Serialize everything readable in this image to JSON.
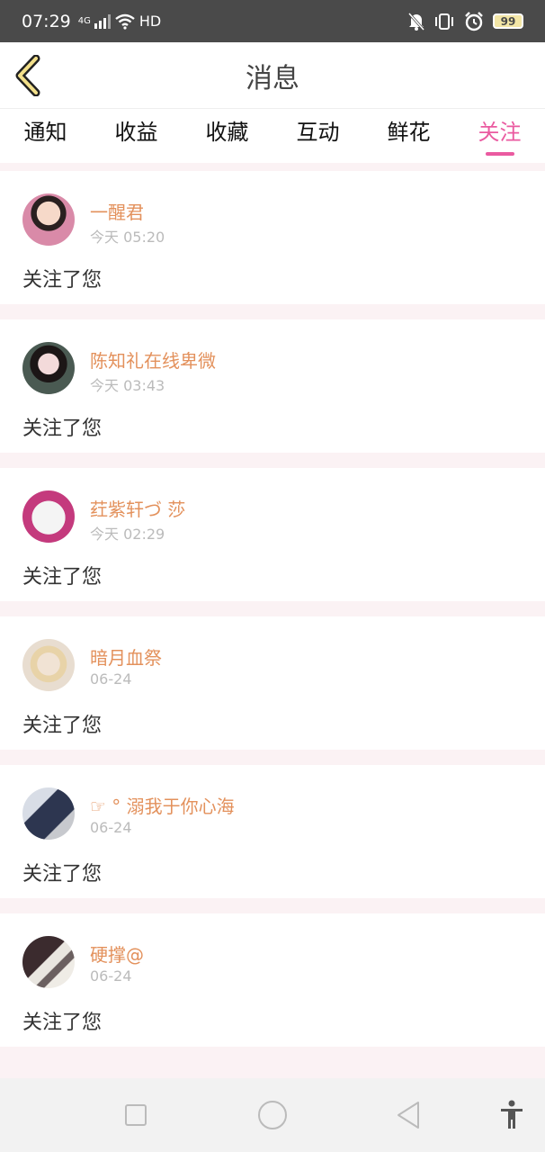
{
  "status_bar": {
    "time": "07:29",
    "network": "4G",
    "hd": "HD",
    "battery": "99"
  },
  "header": {
    "title": "消息"
  },
  "tabs": [
    {
      "label": "通知",
      "active": false
    },
    {
      "label": "收益",
      "active": false
    },
    {
      "label": "收藏",
      "active": false
    },
    {
      "label": "互动",
      "active": false
    },
    {
      "label": "鲜花",
      "active": false
    },
    {
      "label": "关注",
      "active": true
    }
  ],
  "messages": [
    {
      "name": "一醒君",
      "time": "今天 05:20",
      "text": "关注了您",
      "avatar_color": "#d98aa8"
    },
    {
      "name": "陈知礼在线卑微",
      "time": "今天 03:43",
      "text": "关注了您",
      "avatar_color": "#4a5a52"
    },
    {
      "name": "荭紫轩づ 莎",
      "time": "今天 02:29",
      "text": "关注了您",
      "avatar_color": "#c43a7d"
    },
    {
      "name": "暗月血祭",
      "time": "06-24",
      "text": "关注了您",
      "avatar_color": "#e8ddd0"
    },
    {
      "name": "☞ ° 溺我于你心海",
      "time": "06-24",
      "text": "关注了您",
      "avatar_color": "#5d6a86"
    },
    {
      "name": "硬撑@",
      "time": "06-24",
      "text": "关注了您",
      "avatar_color": "#4a3b3b"
    }
  ],
  "colors": {
    "accent": "#ea5aa0",
    "username": "#e3915c",
    "status_bar": "#4a4a4a"
  },
  "icons": {
    "back": "chevron-left-icon",
    "nav_recent": "square-icon",
    "nav_home": "circle-icon",
    "nav_back": "triangle-back-icon",
    "accessibility": "accessibility-icon"
  }
}
